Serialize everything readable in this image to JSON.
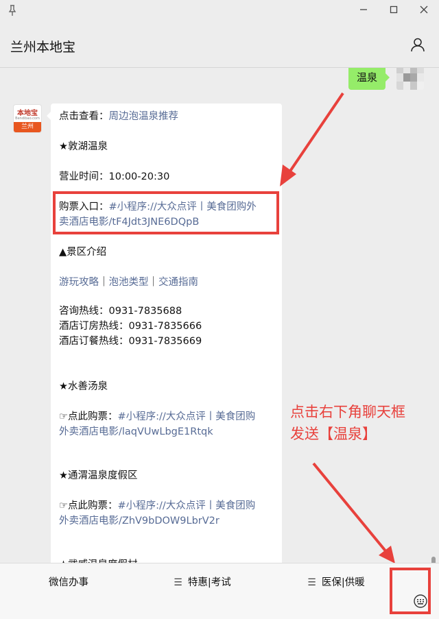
{
  "window": {
    "pin_glyph": "†",
    "minimize": "—",
    "maximize": "▢",
    "close": "✕"
  },
  "header": {
    "title": "兰州本地宝",
    "profile_icon": "person-icon"
  },
  "my_message": {
    "text": "温泉"
  },
  "logo": {
    "top": "本地宝",
    "mid": "Bendibao.com",
    "bottom": "兰州"
  },
  "article": {
    "line1_prefix": "点击查看：",
    "line1_link": "周边泡温泉推荐",
    "s1_title": "★敦湖温泉",
    "s1_hours": "营业时间：10:00-20:30",
    "s1_ticket_prefix": "购票入口：",
    "s1_ticket_link_1": "#小程序://大众点评丨美食团购外",
    "s1_ticket_link_2": "卖酒店电影/tF4Jdt3JNE6DQpB",
    "s1_intro": "▲景区介绍",
    "s1_tab1": "游玩攻略",
    "s1_sep1": "｜",
    "s1_tab2": "泡池类型",
    "s1_sep2": "｜",
    "s1_tab3": "交通指南",
    "s1_phone1": "咨询热线：0931-7835688",
    "s1_phone2": "酒店订房热线：0931-7835666",
    "s1_phone3": "酒店订餐热线：0931-7835669",
    "s2_title": "★水善汤泉",
    "s2_ticket_prefix": "☞点此购票：",
    "s2_ticket_link_1": "#小程序://大众点评丨美食团购",
    "s2_ticket_link_2": "外卖酒店电影/laqVUwLbgE1Rtqk",
    "s3_title": "★通渭温泉度假区",
    "s3_ticket_prefix": "☞点此购票：",
    "s3_ticket_link_1": "#小程序://大众点评丨美食团购",
    "s3_ticket_link_2": "外卖酒店电影/ZhV9bDOW9LbrV2r",
    "s4_title": "★武威温泉度假村"
  },
  "annotation": {
    "line1": "点击右下角聊天框",
    "line2": "发送【温泉】",
    "color": "#e8413c"
  },
  "bottom_menu": {
    "item1": "微信办事",
    "item2": "特惠|考试",
    "item3": "医保|供暖",
    "menu_glyph": "☰"
  }
}
